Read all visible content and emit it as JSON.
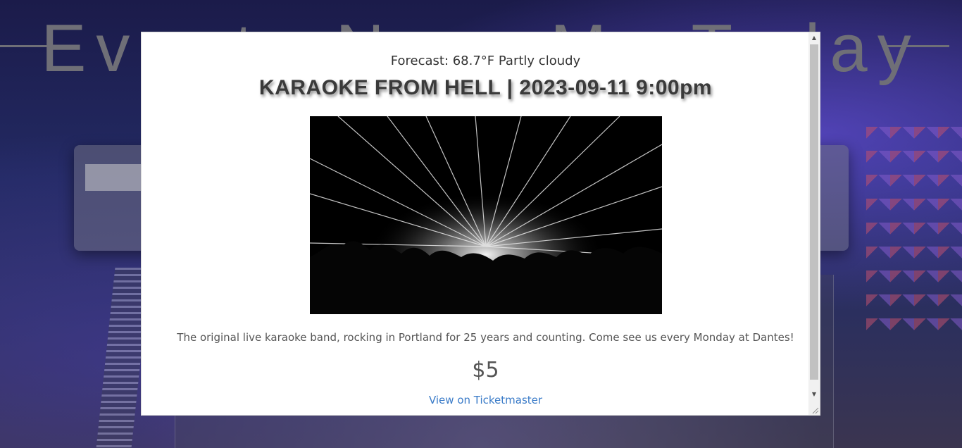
{
  "background": {
    "page_title": "Events Near Me Today"
  },
  "modal": {
    "forecast": "Forecast: 68.7°F Partly cloudy",
    "title": "KARAOKE FROM HELL | 2023-09-11 9:00pm",
    "image_alt": "Concert crowd with laser light show",
    "description": "The original live karaoke band, rocking in Portland for 25 years and counting. Come see us every Monday at Dantes!",
    "price": "$5",
    "link_label": "View on Ticketmaster"
  },
  "scrollbar": {
    "up_arrow": "▲",
    "down_arrow": "▼"
  },
  "colors": {
    "link": "#3a7bc8",
    "title": "#3a3a3a",
    "text": "#555555"
  }
}
